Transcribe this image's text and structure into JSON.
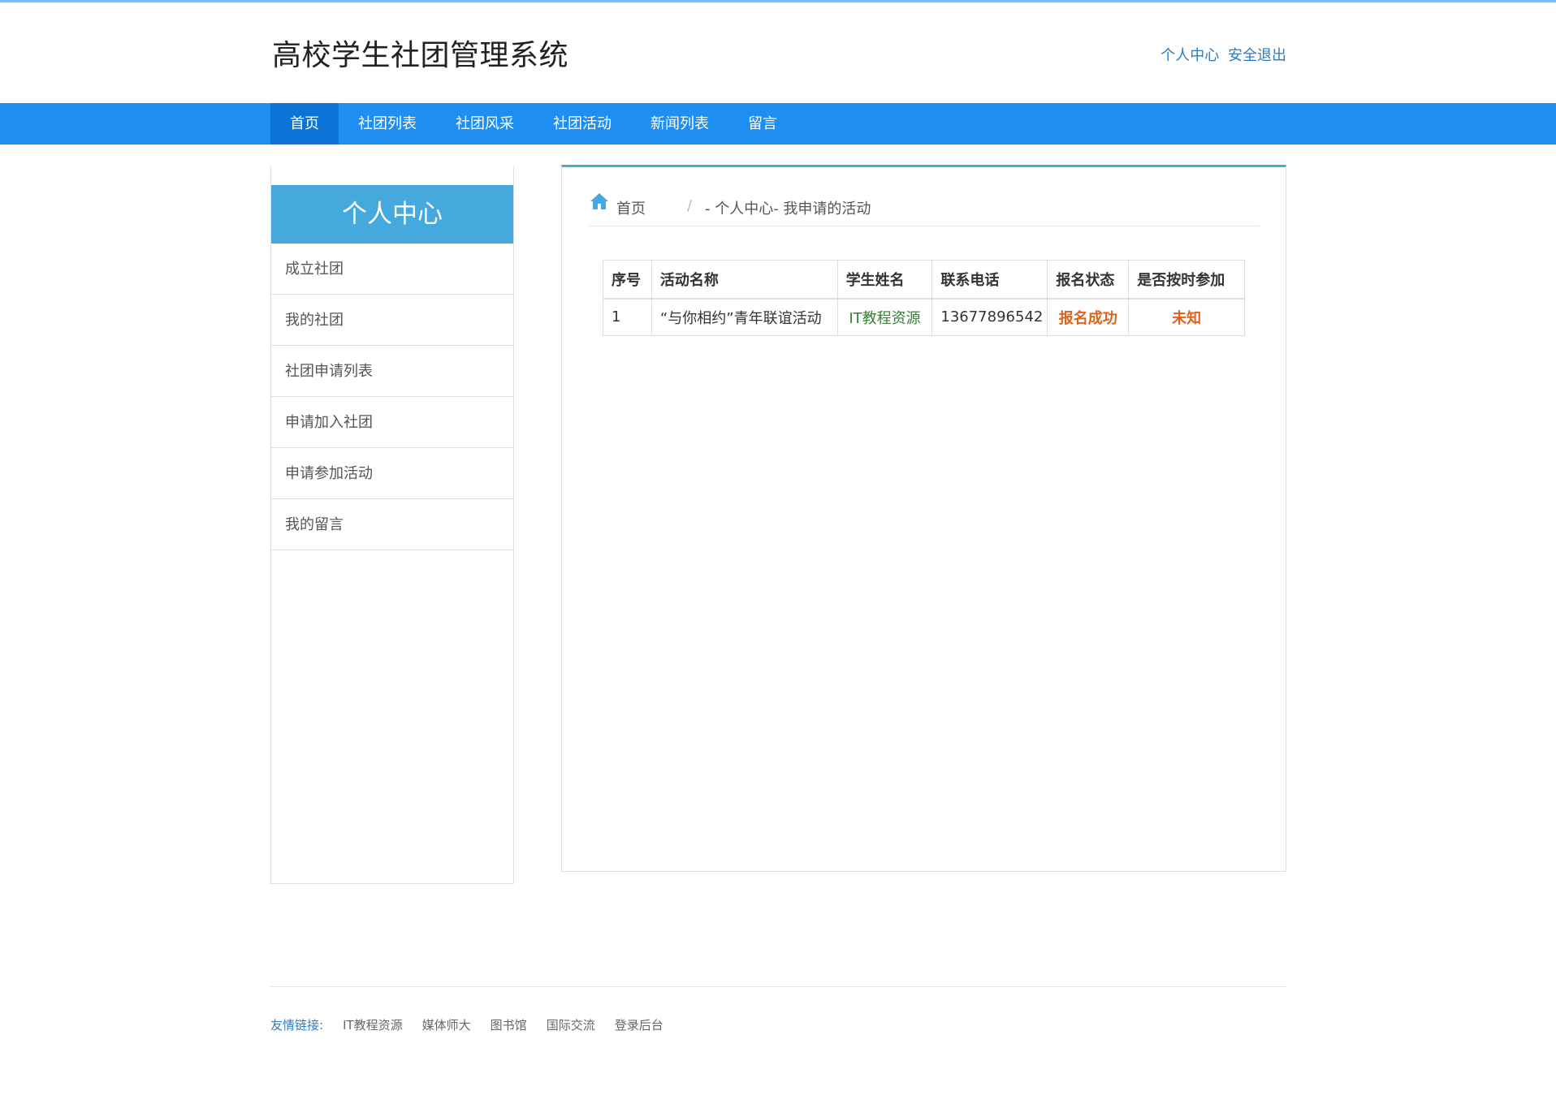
{
  "header": {
    "site_title": "高校学生社团管理系统",
    "user_center_link": "个人中心",
    "logout_link": "安全退出"
  },
  "nav": {
    "items": [
      {
        "label": "首页"
      },
      {
        "label": "社团列表"
      },
      {
        "label": "社团风采"
      },
      {
        "label": "社团活动"
      },
      {
        "label": "新闻列表"
      },
      {
        "label": "留言"
      }
    ],
    "active": "首页"
  },
  "sidebar": {
    "title": "个人中心",
    "items": [
      {
        "label": "成立社团"
      },
      {
        "label": "我的社团"
      },
      {
        "label": "社团申请列表"
      },
      {
        "label": "申请加入社团"
      },
      {
        "label": "申请参加活动"
      },
      {
        "label": "我的留言"
      }
    ]
  },
  "breadcrumb": {
    "home": "首页",
    "separator": "/",
    "current": "- 个人中心- 我申请的活动"
  },
  "table": {
    "headers": [
      "序号",
      "活动名称",
      "学生姓名",
      "联系电话",
      "报名状态",
      "是否按时参加"
    ],
    "rows": [
      {
        "index": "1",
        "activity": "“与你相约”青年联谊活动",
        "student": "IT教程资源",
        "phone": "13677896542",
        "status": "报名成功",
        "attended": "未知"
      }
    ]
  },
  "footer": {
    "label": "友情链接:",
    "links": [
      "IT教程资源",
      "媒体师大",
      "图书馆",
      "国际交流",
      "登录后台"
    ]
  },
  "colors": {
    "nav_bg": "#1e8ef2",
    "nav_active": "#0b74d6",
    "sidebar_head": "#46a9dd",
    "link_blue": "#2f7bc0",
    "status_orange": "#e0611a",
    "student_green": "#3a7d3a"
  },
  "icons": {
    "breadcrumb_home": "home-icon"
  }
}
